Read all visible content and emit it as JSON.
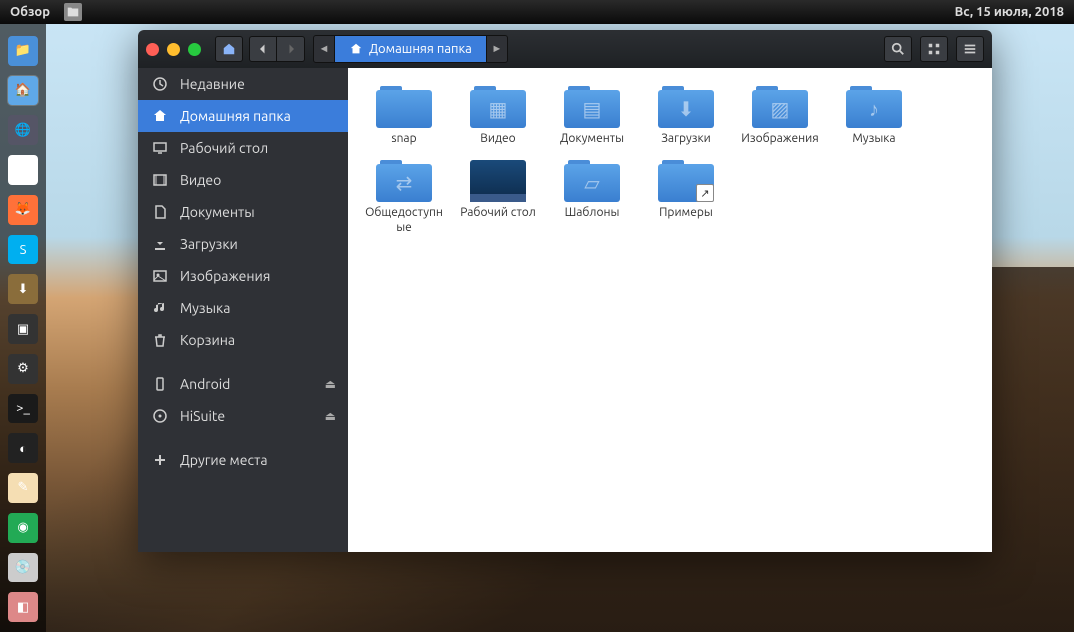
{
  "topbar": {
    "activities": "Обзор",
    "datetime": "Вс, 15 июля, 2018"
  },
  "dock": [
    {
      "name": "files",
      "color": "#4a90d9",
      "glyph": "📁",
      "active": false
    },
    {
      "name": "files-active",
      "color": "#5fa8e8",
      "glyph": "🏠",
      "active": true
    },
    {
      "name": "web",
      "color": "#556",
      "glyph": "🌐",
      "active": false
    },
    {
      "name": "chrome",
      "color": "#fff",
      "glyph": "◉",
      "active": false
    },
    {
      "name": "firefox",
      "color": "#ff7139",
      "glyph": "🦊",
      "active": false
    },
    {
      "name": "skype",
      "color": "#00aff0",
      "glyph": "S",
      "active": false
    },
    {
      "name": "software",
      "color": "#8a6d3b",
      "glyph": "⬇",
      "active": false
    },
    {
      "name": "screenshot",
      "color": "#333",
      "glyph": "▣",
      "active": false
    },
    {
      "name": "settings",
      "color": "#333",
      "glyph": "⚙",
      "active": false
    },
    {
      "name": "terminal",
      "color": "#1a1a1a",
      "glyph": ">_",
      "active": false
    },
    {
      "name": "color",
      "color": "#222",
      "glyph": "◐",
      "active": false
    },
    {
      "name": "notes",
      "color": "#f5deb3",
      "glyph": "✎",
      "active": false
    },
    {
      "name": "shutter",
      "color": "#2a5",
      "glyph": "◉",
      "active": false
    },
    {
      "name": "disk",
      "color": "#ccc",
      "glyph": "💿",
      "active": false
    },
    {
      "name": "app",
      "color": "#d88",
      "glyph": "◧",
      "active": false
    }
  ],
  "window": {
    "breadcrumb": "Домашняя папка",
    "sidebar": [
      {
        "icon": "recent",
        "label": "Недавние",
        "key": "recent"
      },
      {
        "icon": "home",
        "label": "Домашняя папка",
        "key": "home",
        "selected": true
      },
      {
        "icon": "desktop",
        "label": "Рабочий стол",
        "key": "desktop"
      },
      {
        "icon": "video",
        "label": "Видео",
        "key": "videos"
      },
      {
        "icon": "documents",
        "label": "Документы",
        "key": "documents"
      },
      {
        "icon": "downloads",
        "label": "Загрузки",
        "key": "downloads"
      },
      {
        "icon": "pictures",
        "label": "Изображения",
        "key": "pictures"
      },
      {
        "icon": "music",
        "label": "Музыка",
        "key": "music"
      },
      {
        "icon": "trash",
        "label": "Корзина",
        "key": "trash"
      }
    ],
    "devices": [
      {
        "icon": "phone",
        "label": "Android",
        "key": "android",
        "eject": true
      },
      {
        "icon": "disc",
        "label": "HiSuite",
        "key": "hisuite",
        "eject": true
      }
    ],
    "other": {
      "icon": "plus",
      "label": "Другие места",
      "key": "other"
    },
    "files": [
      {
        "name": "snap",
        "type": "folder",
        "glyph": ""
      },
      {
        "name": "Видео",
        "type": "folder",
        "glyph": "film"
      },
      {
        "name": "Документы",
        "type": "folder",
        "glyph": "doc"
      },
      {
        "name": "Загрузки",
        "type": "folder",
        "glyph": "download"
      },
      {
        "name": "Изображения",
        "type": "folder",
        "glyph": "picture"
      },
      {
        "name": "Музыка",
        "type": "folder",
        "glyph": "music"
      },
      {
        "name": "Общедоступные",
        "type": "folder",
        "glyph": "share"
      },
      {
        "name": "Рабочий стол",
        "type": "desktop",
        "glyph": ""
      },
      {
        "name": "Шаблоны",
        "type": "folder",
        "glyph": "template"
      },
      {
        "name": "Примеры",
        "type": "folder-link",
        "glyph": ""
      }
    ]
  }
}
